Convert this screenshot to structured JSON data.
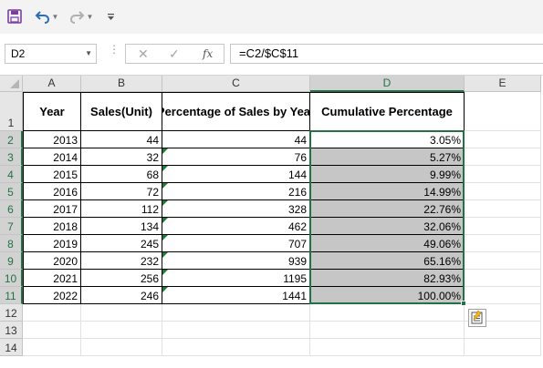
{
  "formula_bar": {
    "name_box": "D2",
    "formula": "=C2/$C$11",
    "fx_label": "fx"
  },
  "columns": [
    "A",
    "B",
    "C",
    "D",
    "E"
  ],
  "rows": [
    "1",
    "2",
    "3",
    "4",
    "5",
    "6",
    "7",
    "8",
    "9",
    "10",
    "11",
    "12",
    "13",
    "14"
  ],
  "headers": {
    "year": "Year",
    "sales": "Sales(Unit)",
    "pct_by_year": "Percentage of Sales by Year",
    "cumulative": "Cumulative Percentage"
  },
  "table": [
    {
      "year": "2013",
      "sales": "44",
      "c": "44",
      "d": "3.05%"
    },
    {
      "year": "2014",
      "sales": "32",
      "c": "76",
      "d": "5.27%"
    },
    {
      "year": "2015",
      "sales": "68",
      "c": "144",
      "d": "9.99%"
    },
    {
      "year": "2016",
      "sales": "72",
      "c": "216",
      "d": "14.99%"
    },
    {
      "year": "2017",
      "sales": "112",
      "c": "328",
      "d": "22.76%"
    },
    {
      "year": "2018",
      "sales": "134",
      "c": "462",
      "d": "32.06%"
    },
    {
      "year": "2019",
      "sales": "245",
      "c": "707",
      "d": "49.06%"
    },
    {
      "year": "2020",
      "sales": "232",
      "c": "939",
      "d": "65.16%"
    },
    {
      "year": "2021",
      "sales": "256",
      "c": "1195",
      "d": "82.93%"
    },
    {
      "year": "2022",
      "sales": "246",
      "c": "1441",
      "d": "100.00%"
    }
  ],
  "icons": {
    "save": "save-icon",
    "undo": "undo-icon",
    "redo": "redo-icon",
    "customize": "customize-toolbar-icon",
    "cancel": "cancel-icon",
    "enter": "enter-icon",
    "quick_analysis": "quick-analysis-icon"
  },
  "colors": {
    "accent": "#217346",
    "selection_fill": "#c6c6c6",
    "error_triangle": "#1e7b34",
    "save_icon": "#7b3fa0",
    "undo_icon": "#2f6db5"
  }
}
